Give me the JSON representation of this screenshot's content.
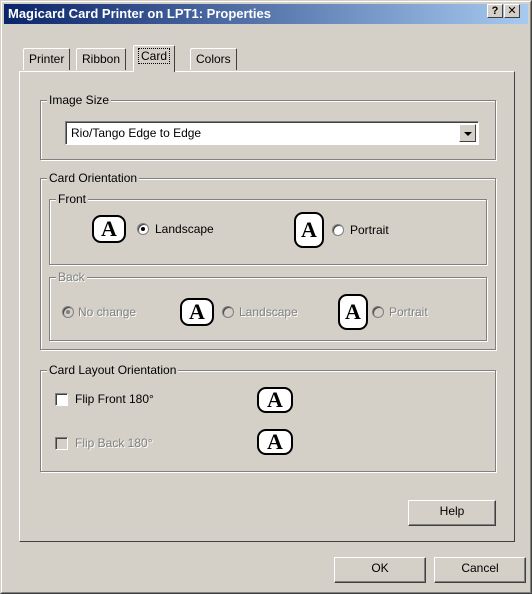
{
  "window": {
    "title": "Magicard Card Printer on LPT1: Properties"
  },
  "titlebar_buttons": {
    "help": "?",
    "close": "✕"
  },
  "tabs": [
    {
      "label": "Printer"
    },
    {
      "label": "Ribbon"
    },
    {
      "label": "Card"
    },
    {
      "label": "Colors"
    }
  ],
  "active_tab": "Card",
  "image_size": {
    "legend": "Image Size",
    "selected": "Rio/Tango Edge to Edge"
  },
  "card_orientation": {
    "legend": "Card Orientation",
    "front": {
      "legend": "Front",
      "landscape_label": "Landscape",
      "portrait_label": "Portrait",
      "selected": "Landscape"
    },
    "back": {
      "legend": "Back",
      "no_change_label": "No change",
      "landscape_label": "Landscape",
      "portrait_label": "Portrait",
      "selected": "No change",
      "enabled": false
    }
  },
  "card_layout": {
    "legend": "Card Layout Orientation",
    "flip_front_label": "Flip Front 180°",
    "flip_front_checked": false,
    "flip_back_label": "Flip Back 180°",
    "flip_back_checked": false,
    "flip_back_enabled": false
  },
  "icon_glyph": "A",
  "buttons": {
    "help": "Help",
    "ok": "OK",
    "cancel": "Cancel"
  }
}
